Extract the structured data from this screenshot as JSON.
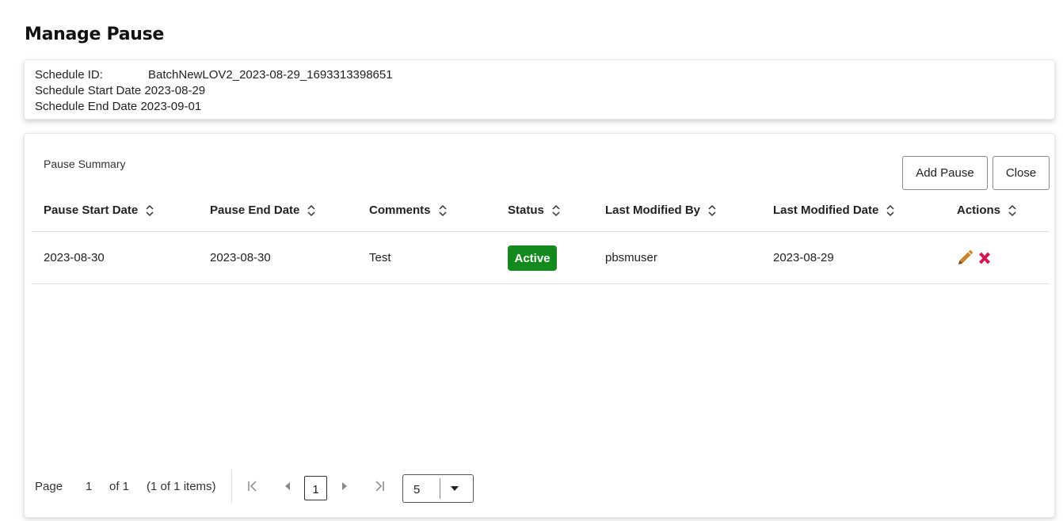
{
  "page": {
    "title": "Manage Pause"
  },
  "schedule": {
    "id_label": "Schedule ID:",
    "id_value": "BatchNewLOV2_2023-08-29_1693313398651",
    "start_label": "Schedule Start Date",
    "start_value": "2023-08-29",
    "end_label": "Schedule End Date",
    "end_value": "2023-09-01"
  },
  "summary": {
    "title": "Pause Summary",
    "add_button": "Add Pause",
    "close_button": "Close"
  },
  "table": {
    "columns": [
      "Pause Start Date",
      "Pause End Date",
      "Comments",
      "Status",
      "Last Modified By",
      "Last Modified Date",
      "Actions"
    ],
    "rows": [
      {
        "pause_start": "2023-08-30",
        "pause_end": "2023-08-30",
        "comments": "Test",
        "status": "Active",
        "last_modified_by": "pbsmuser",
        "last_modified_date": "2023-08-29",
        "actions": [
          "edit-icon",
          "delete-icon"
        ]
      }
    ]
  },
  "pager": {
    "page_label": "Page",
    "page_value": "1",
    "of_label": "of 1",
    "items_label": "(1 of 1 items)",
    "current_page": "1",
    "page_size": "5"
  },
  "colors": {
    "status_active": "#148a1e",
    "edit_icon": "#c8862c",
    "delete_icon": "#d0174f"
  }
}
